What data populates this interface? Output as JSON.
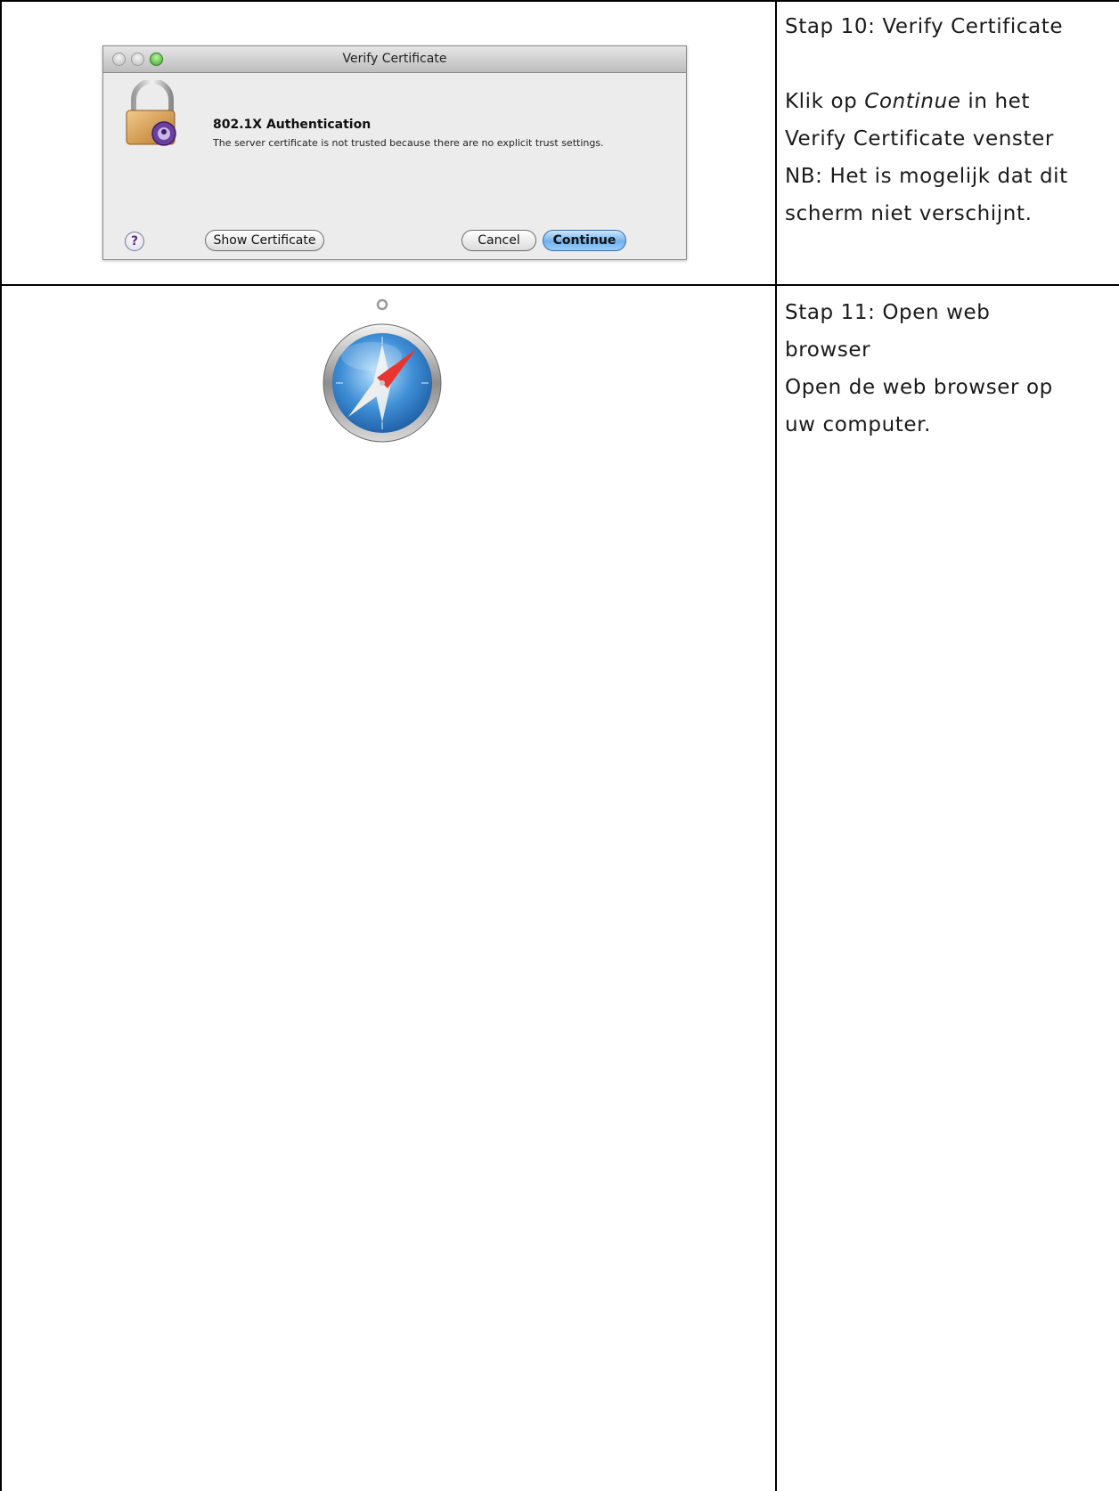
{
  "steps": [
    {
      "lines": [
        "Stap 10: Verify Certificate",
        "",
        "Klik op ",
        "Verify Certificate venster",
        "NB: Het is mogelijk dat dit",
        "scherm niet verschijnt."
      ],
      "line3_italic": "Continue",
      "line3_tail": " in het"
    },
    {
      "lines": [
        "Stap 11: Open web",
        "browser",
        "Open de web browser op",
        "uw computer."
      ]
    }
  ],
  "dialog": {
    "title": "Verify Certificate",
    "heading": "802.1X Authentication",
    "message": "The server certificate is not trusted because there are no explicit trust settings.",
    "help_label": "?",
    "show_certificate_label": "Show Certificate",
    "cancel_label": "Cancel",
    "continue_label": "Continue",
    "icon": "padlock-certificate-icon"
  },
  "safari": {
    "icon": "safari-compass-icon"
  }
}
